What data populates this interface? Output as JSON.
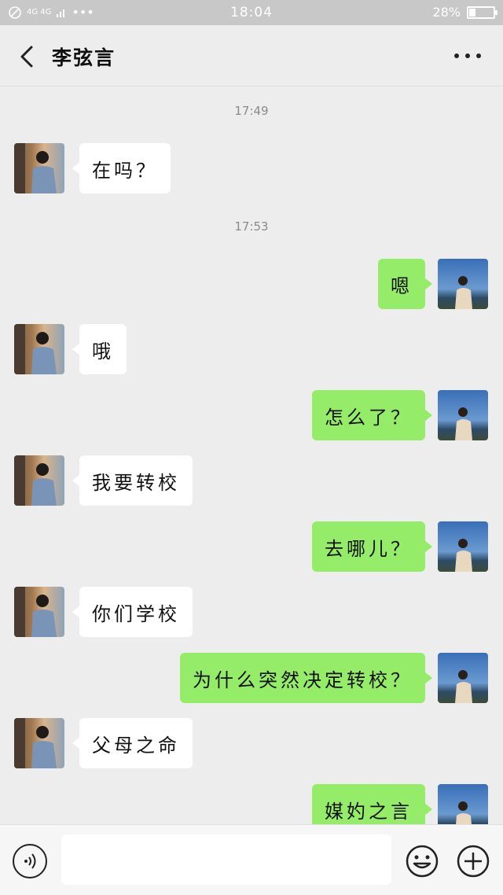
{
  "status_bar": {
    "network": "4G 4G",
    "dots": "•••",
    "time": "18:04",
    "battery_percent": "28%",
    "battery_level": 0.28
  },
  "header": {
    "title": "李弦言",
    "back_icon": "chevron-left-icon",
    "more_icon": "more-dots-icon"
  },
  "chat": {
    "times": [
      "17:49",
      "17:53"
    ],
    "messages": [
      {
        "side": "in",
        "text": "在吗？"
      },
      {
        "side": "out",
        "text": "嗯"
      },
      {
        "side": "in",
        "text": "哦"
      },
      {
        "side": "out",
        "text": "怎么了？"
      },
      {
        "side": "in",
        "text": "我要转校"
      },
      {
        "side": "out",
        "text": "去哪儿？"
      },
      {
        "side": "in",
        "text": "你们学校"
      },
      {
        "side": "out",
        "text": "为什么突然决定转校？"
      },
      {
        "side": "in",
        "text": "父母之命"
      },
      {
        "side": "out",
        "text": "媒妁之言"
      }
    ]
  },
  "input_bar": {
    "value": "",
    "voice_icon": "voice-icon",
    "emoji_icon": "emoji-icon",
    "plus_icon": "plus-icon"
  },
  "colors": {
    "outgoing_bubble": "#95ec69",
    "incoming_bubble": "#ffffff",
    "background": "#ededed"
  }
}
